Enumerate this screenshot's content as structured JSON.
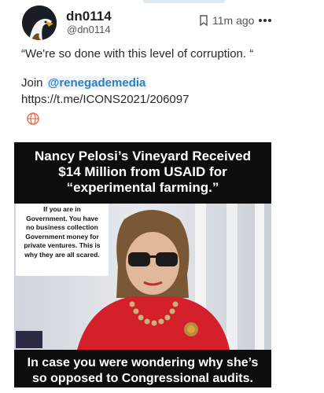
{
  "post": {
    "display_name": "dn0114",
    "handle": "@dn0114",
    "time": "11m ago",
    "more_icon": "ellipsis-icon",
    "bookmark_icon": "bookmark-icon",
    "quote": "“We're so done with this level of corruption. “",
    "join_label": "Join",
    "mention": "@renegademedia",
    "link": "https://t.me/ICONS2021/206097",
    "translate_icon": "globe-icon",
    "accent_color": "#2a7fc3"
  },
  "media": {
    "headline_lines": [
      "Nancy Pelosi’s Vineyard Received",
      "$14 Million from USAID for",
      "“experimental farming.”"
    ],
    "caption_lines": [
      "If you are in",
      "Government. You have",
      "no business collection",
      "Government money for",
      "private ventures. This is",
      "why they are all scared."
    ],
    "bottom_lines": [
      "In case you were wondering why she’s",
      "so opposed to Congressional audits."
    ]
  }
}
